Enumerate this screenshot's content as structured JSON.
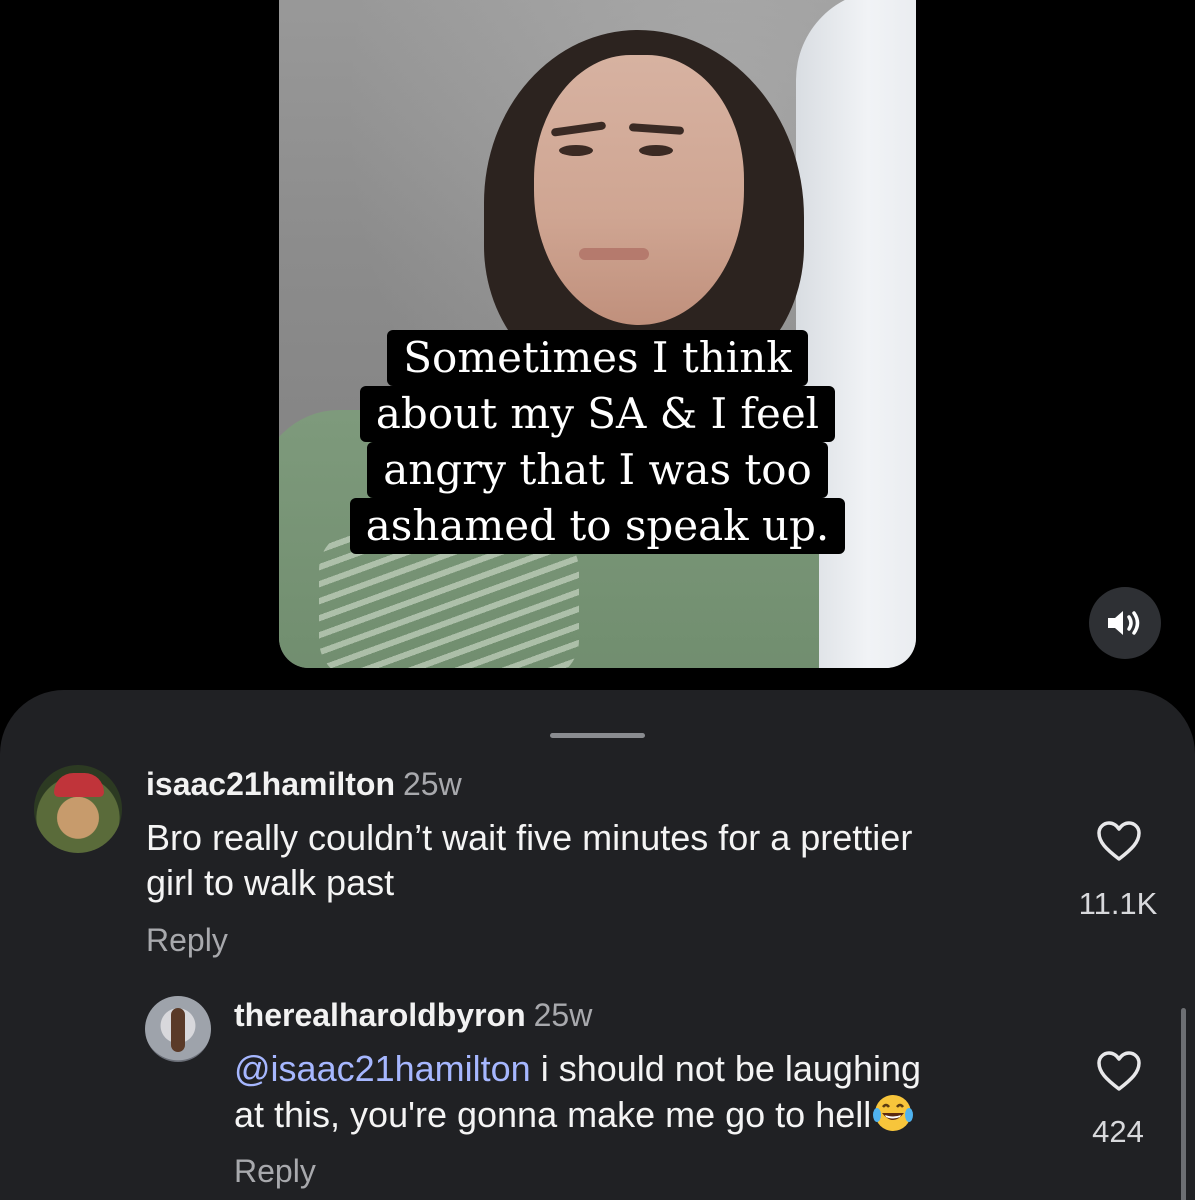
{
  "video": {
    "caption_lines": [
      "Sometimes I think",
      "about my SA & I feel",
      "angry that I was too",
      "ashamed to speak up."
    ],
    "mute_icon": "speaker-icon"
  },
  "comments": [
    {
      "username": "isaac21hamilton",
      "time": "25w",
      "text_lines": [
        "Bro really couldn’t wait five minutes for a prettier",
        "girl to walk past"
      ],
      "reply_label": "Reply",
      "likes": "11.1K"
    },
    {
      "username": "therealharoldbyron",
      "time": "25w",
      "mention": "@isaac21hamilton",
      "text_line1": " i should not be laughing",
      "text_line2": "at this, you're gonna make me go to hell",
      "emoji": "face-with-tears-of-joy",
      "reply_label": "Reply",
      "likes": "424"
    }
  ],
  "colors": {
    "sheet_bg": "#202124",
    "mention": "#a6b7ff",
    "muted_text": "#a8a9ad"
  }
}
